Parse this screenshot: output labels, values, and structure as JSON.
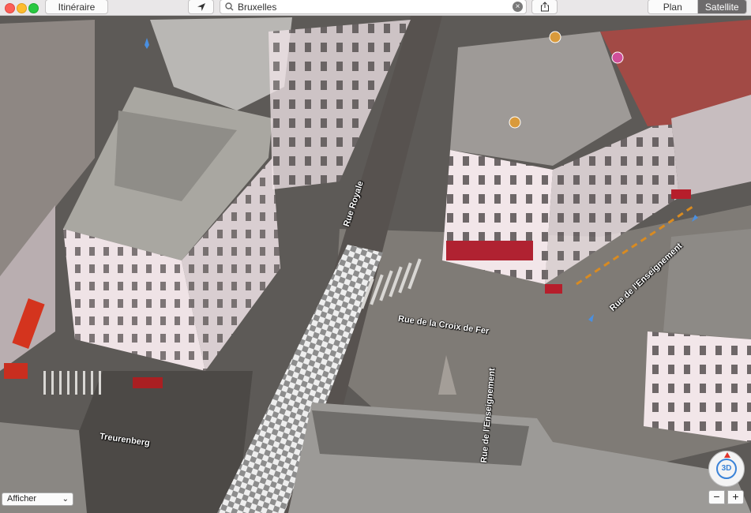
{
  "toolbar": {
    "itinerary_label": "Itinéraire",
    "search_value": "Bruxelles",
    "plan_label": "Plan",
    "satellite_label": "Satellite"
  },
  "map": {
    "mode": "Satellite",
    "street_labels": {
      "rue_royale": "Rue Royale",
      "croix_de_fer": "Rue de la Croix de Fer",
      "enseignement_right": "Rue de l'Enseignement",
      "enseignement_bottom": "Rue de l'Enseignement",
      "treurenberg": "Treurenberg"
    },
    "show_menu_label": "Afficher",
    "compass_label": "3D",
    "zoom_out_label": "−",
    "zoom_in_label": "+"
  },
  "colors": {
    "accent_blue": "#3a83d8",
    "compass_red": "#e0342c",
    "satellite_selected": "#6d6b6c"
  }
}
